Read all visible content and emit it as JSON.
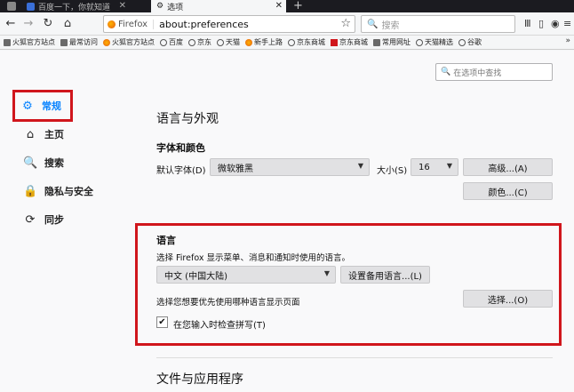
{
  "tabs": [
    {
      "title": "百度一下，你就知道",
      "active": false
    },
    {
      "title": "选项",
      "active": true
    }
  ],
  "urlbar": {
    "identity": "Firefox",
    "url": "about:preferences"
  },
  "searchbar": {
    "placeholder": "搜索"
  },
  "bookmarks": [
    {
      "label": "火狐官方站点",
      "icon": "folder"
    },
    {
      "label": "最常访问",
      "icon": "folder"
    },
    {
      "label": "火狐官方站点",
      "icon": "firefox"
    },
    {
      "label": "百度",
      "icon": "globe"
    },
    {
      "label": "京东",
      "icon": "globe"
    },
    {
      "label": "天猫",
      "icon": "globe"
    },
    {
      "label": "新手上路",
      "icon": "firefox"
    },
    {
      "label": "京东商城",
      "icon": "globe"
    },
    {
      "label": "京东商城",
      "icon": "red"
    },
    {
      "label": "常用网址",
      "icon": "folder"
    },
    {
      "label": "天猫精选",
      "icon": "globe"
    },
    {
      "label": "谷歌",
      "icon": "globe"
    }
  ],
  "find": {
    "placeholder": "在选项中查找"
  },
  "sidebar": {
    "items": [
      {
        "label": "常规",
        "icon": "gear-icon",
        "active": true
      },
      {
        "label": "主页",
        "icon": "home-icon",
        "active": false
      },
      {
        "label": "搜索",
        "icon": "search-icon",
        "active": false
      },
      {
        "label": "隐私与安全",
        "icon": "lock-icon",
        "active": false
      },
      {
        "label": "同步",
        "icon": "sync-icon",
        "active": false
      }
    ]
  },
  "main": {
    "section_title": "语言与外观",
    "fonts": {
      "heading": "字体和颜色",
      "default_font_label": "默认字体(D)",
      "default_font_value": "微软雅黑",
      "size_label": "大小(S)",
      "size_value": "16",
      "advanced_button": "高级...(A)",
      "colors_button": "颜色...(C)"
    },
    "language": {
      "heading": "语言",
      "description": "选择 Firefox 显示菜单、消息和通知时使用的语言。",
      "selected_language": "中文 (中国大陆)",
      "alternatives_button": "设置备用语言...(L)",
      "page_language_label": "选择您想要优先使用哪种语言显示页面",
      "choose_button": "选择...(O)",
      "spellcheck_label": "在您输入时检查拼写(T)",
      "spellcheck_checked": true
    },
    "next_section_title": "文件与应用程序"
  },
  "colors": {
    "accent": "#0a84ff",
    "highlight_box": "#d0161c"
  }
}
